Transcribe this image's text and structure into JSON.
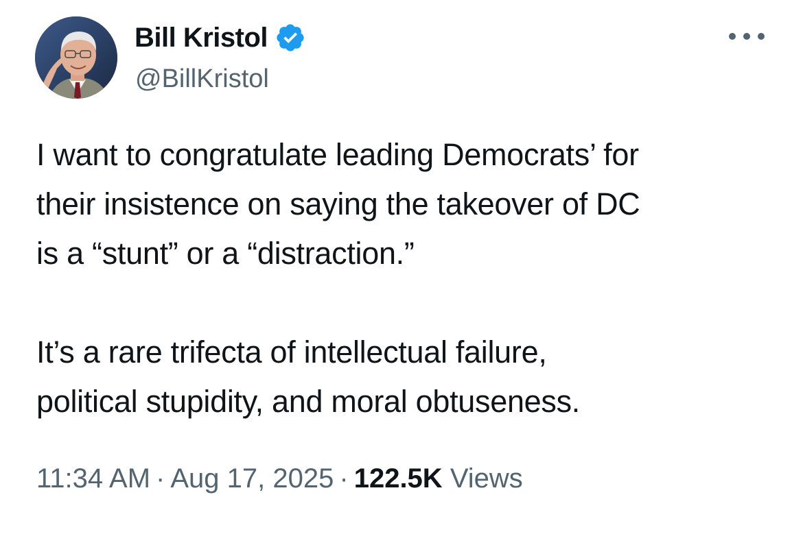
{
  "author": {
    "display_name": "Bill Kristol",
    "handle": "@BillKristol",
    "verified": true,
    "verified_color": "#1d9bf0",
    "avatar_icon": "profile-photo"
  },
  "more_menu_icon": "more-horizontal-icon",
  "tweet": {
    "paragraphs": [
      "I want to congratulate leading Democrats’ for\ntheir insistence on saying the takeover of DC\nis a “stunt” or a “distraction.”",
      "It’s a rare trifecta of intellectual failure,\npolitical stupidity, and moral obtuseness."
    ]
  },
  "meta": {
    "time": "11:34 AM",
    "date": "Aug 17, 2025",
    "separator": "·",
    "views_count": "122.5K",
    "views_label": "Views"
  },
  "colors": {
    "text_primary": "#0f1419",
    "text_secondary": "#536471",
    "background": "#ffffff"
  }
}
